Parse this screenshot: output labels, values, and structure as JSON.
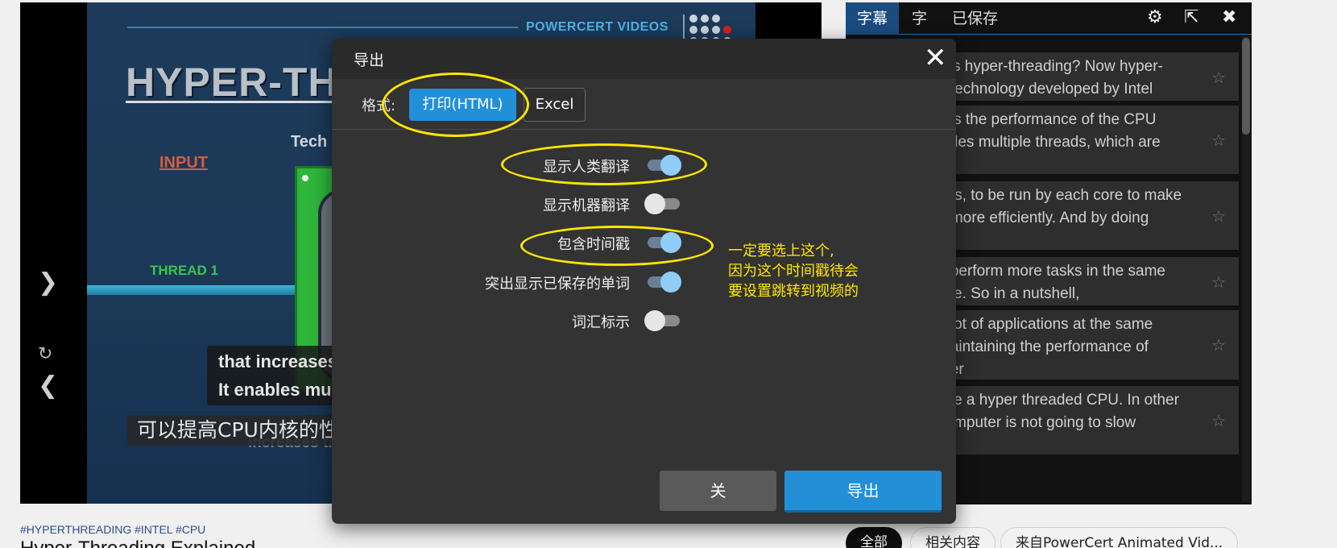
{
  "video": {
    "brand": "POWERCERT VIDEOS",
    "slide_title": "HYPER-THRE",
    "slide_subtitle": "Tech",
    "input_label": "INPUT",
    "thread_label": "THREAD 1",
    "caption_en": [
      "that increases",
      "It enables mult"
    ],
    "caption_zh": "可以提高CPU内核的性能",
    "ghost_text": "increases th",
    "next_icon": "chevron-right-icon",
    "prev_icon": "chevron-left-icon",
    "replay_icon": "replay-icon"
  },
  "below_video": {
    "hashtags": "#HYPERTHREADING #INTEL #CPU",
    "title": "Hyper-Threading Explained"
  },
  "panel": {
    "tabs": [
      {
        "label": "字幕",
        "active": true
      },
      {
        "label": "字",
        "active": false
      },
      {
        "label": "已保存",
        "active": false
      }
    ],
    "icons": [
      "gear-icon",
      "export-icon",
      "close-icon"
    ],
    "subtitles": [
      {
        "lines": [
          "y is hyper-threading? Now  hyper-",
          "a technology developed by Intel"
        ]
      },
      {
        "lines": [
          "ses the performance of the CPU",
          "ables multiple threads, which are",
          ""
        ]
      },
      {
        "lines": [
          "ons, to be run by each core to make",
          "n more efficiently. And by doing",
          ""
        ]
      },
      {
        "lines": [
          "n perform more tasks in the  same",
          "ime. So in a nutshell,"
        ]
      },
      {
        "lines": [
          "a lot of applications at the same",
          "maintaining the performance of",
          "uter"
        ]
      },
      {
        "lines": [
          "ave a hyper threaded CPU. In other",
          " computer is not going to slow",
          ""
        ]
      }
    ]
  },
  "filter_chips": [
    "全部",
    "相关内容",
    "来自PowerCert Animated Vid..."
  ],
  "modal": {
    "title": "导出",
    "format_label": "格式:",
    "format_html": "打印(HTML)",
    "format_excel": "Excel",
    "options": [
      {
        "label": "显示人类翻译",
        "on": true
      },
      {
        "label": "显示机器翻译",
        "on": false
      },
      {
        "label": "包含时间戳",
        "on": true
      },
      {
        "label": "突出显示已保存的单词",
        "on": true
      },
      {
        "label": "词汇标示",
        "on": false
      }
    ],
    "close_button": "关",
    "export_button": "导出"
  },
  "annotation": {
    "note_lines": [
      "一定要选上这个,",
      "因为这个时间戳待会",
      "要设置跳转到视频的"
    ],
    "color": "#ffe600"
  }
}
